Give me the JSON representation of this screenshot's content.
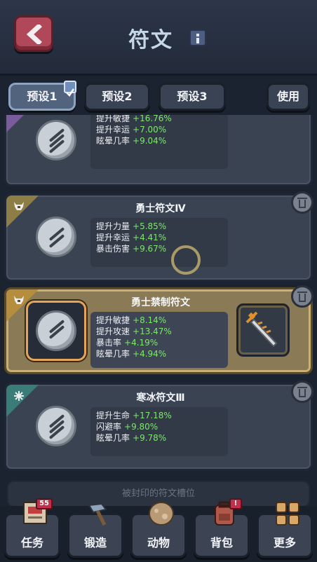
{
  "header": {
    "title": "符文"
  },
  "presets": {
    "items": [
      "预设1",
      "预设2",
      "预设3"
    ],
    "use_label": "使用",
    "active_index": 0
  },
  "runes": [
    {
      "title": "",
      "corner_icon": "",
      "stats": [
        {
          "name": "提升敏捷",
          "value": "+16.76%"
        },
        {
          "name": "提升幸运",
          "value": "+7.00%"
        },
        {
          "name": "眩晕几率",
          "value": "+9.04%"
        }
      ]
    },
    {
      "title": "勇士符文Ⅳ",
      "corner_icon": "helmet-icon",
      "stats": [
        {
          "name": "提升力量",
          "value": "+5.85%"
        },
        {
          "name": "提升幸运",
          "value": "+4.41%"
        },
        {
          "name": "暴击伤害",
          "value": "+9.67%"
        }
      ]
    },
    {
      "title": "勇士禁制符文",
      "corner_icon": "helmet-icon",
      "selected": true,
      "stats": [
        {
          "name": "提升敏捷",
          "value": "+8.14%"
        },
        {
          "name": "提升攻速",
          "value": "+13.47%"
        },
        {
          "name": "暴击率",
          "value": "+4.19%"
        },
        {
          "name": "眩晕几率",
          "value": "+4.94%"
        }
      ]
    },
    {
      "title": "寒冰符文Ⅲ",
      "corner_icon": "snowflake-icon",
      "stats": [
        {
          "name": "提升生命",
          "value": "+17.18%"
        },
        {
          "name": "闪避率",
          "value": "+9.80%"
        },
        {
          "name": "眩晕几率",
          "value": "+9.78%"
        }
      ]
    }
  ],
  "sealed_slot_label": "被封印的符文槽位",
  "nav": [
    {
      "label": "任务",
      "icon": "quest-icon",
      "badge": "55"
    },
    {
      "label": "锻造",
      "icon": "hammer-icon",
      "badge": ""
    },
    {
      "label": "动物",
      "icon": "egg-icon",
      "badge": ""
    },
    {
      "label": "背包",
      "icon": "backpack-icon",
      "badge": "!"
    },
    {
      "label": "更多",
      "icon": "grid-icon",
      "badge": ""
    }
  ],
  "colors": {
    "stat_value": "#7de86a",
    "selected_frame": "#e6a45a"
  }
}
